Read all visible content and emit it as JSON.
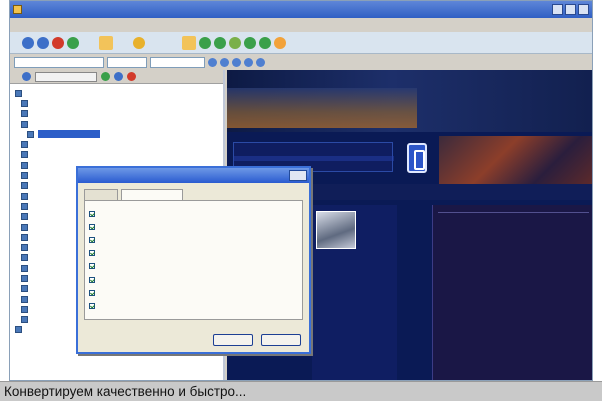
{
  "caption": "Конвертируем качественно и быстро...",
  "window": {
    "title": ""
  },
  "menubar": {
    "items": [
      "",
      "",
      "",
      "",
      "",
      "",
      ""
    ]
  },
  "toolbar": {
    "items": [
      "",
      "",
      "",
      "",
      "",
      ""
    ]
  },
  "address": {
    "value": ""
  },
  "left_pane": {
    "selector": "",
    "tree": [
      "",
      "",
      "",
      "",
      "",
      "",
      "",
      "",
      "",
      "",
      "",
      "",
      "",
      "",
      "",
      "",
      "",
      "",
      "",
      "",
      "",
      "",
      "",
      ""
    ]
  },
  "web": {
    "promo": "",
    "logo": "",
    "nav": [
      "",
      "",
      ""
    ],
    "mid_links": [
      "",
      "",
      "",
      "",
      "",
      "",
      "",
      "",
      "",
      "",
      "",
      "",
      "",
      "",
      "",
      "",
      "",
      ""
    ],
    "right_lines": [
      "",
      "",
      "",
      "",
      "",
      "",
      "",
      "",
      "",
      "",
      "",
      "",
      "",
      "",
      "",
      "",
      "",
      ""
    ]
  },
  "dialog": {
    "title": "",
    "tabs": [
      "",
      ""
    ],
    "options": [
      "",
      "",
      "",
      "",
      "",
      "",
      "",
      ""
    ],
    "buttons": [
      "",
      ""
    ],
    "close": ""
  }
}
